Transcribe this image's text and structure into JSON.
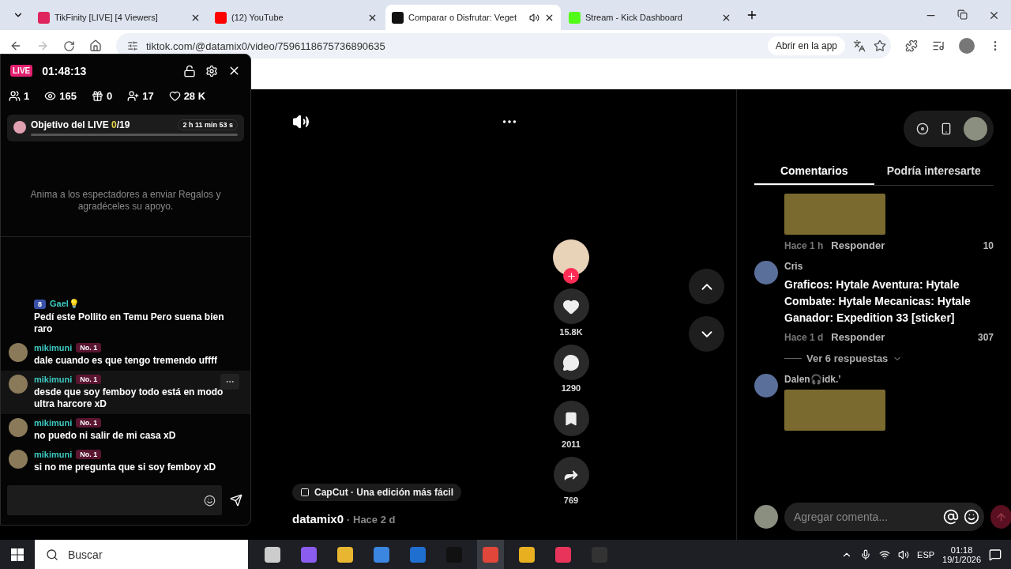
{
  "browser": {
    "tabs": [
      {
        "title": "TikFinity [LIVE] [4 Viewers]",
        "selected": false,
        "kind": "tikfinity",
        "audio": false
      },
      {
        "title": "(12) YouTube",
        "selected": false,
        "kind": "youtube",
        "audio": false
      },
      {
        "title": "Comparar o Disfrutar: Veget",
        "selected": true,
        "kind": "tiktok",
        "audio": true
      },
      {
        "title": "Stream - Kick Dashboard",
        "selected": false,
        "kind": "kick",
        "audio": false
      }
    ],
    "url": "tiktok.com/@datamix0/video/7596118675736890635",
    "open_app": "Abrir en la app"
  },
  "overlay": {
    "live_badge": "LIVE",
    "timer": "01:48:13",
    "stats": [
      {
        "kind": "users",
        "value": "1"
      },
      {
        "kind": "views",
        "value": "165"
      },
      {
        "kind": "gifts",
        "value": "0"
      },
      {
        "kind": "follows",
        "value": "17"
      },
      {
        "kind": "likes",
        "value": "28 K"
      }
    ],
    "goal": {
      "label": "Objetivo del LIVE",
      "current": "0",
      "total": "/19",
      "remaining": "2 h 11 min 53 s",
      "level": 0
    },
    "hint": "Anima a los espectadores a enviar Regalos y agradéceles su apoyo.",
    "messages": [
      {
        "user": "Gael💡",
        "avatar": false,
        "level_badge": "8",
        "text": "Pedí este Pollito en Temu Pero suena bien raro",
        "highlighted": false
      },
      {
        "user": "mikimuni",
        "avatar": true,
        "rank": "No. 1",
        "text": "dale cuando es que tengo tremendo uffff",
        "highlighted": false
      },
      {
        "user": "mikimuni",
        "avatar": true,
        "rank": "No. 1",
        "text": "desde que soy femboy todo está en modo ultra harcore xD",
        "highlighted": true
      },
      {
        "user": "mikimuni",
        "avatar": true,
        "rank": "No. 1",
        "text": "no puedo ni salir de mi casa xD",
        "highlighted": false
      },
      {
        "user": "mikimuni",
        "avatar": true,
        "rank": "No. 1",
        "text": "si no me pregunta que si soy femboy xD",
        "highlighted": false
      }
    ]
  },
  "video": {
    "actions": [
      {
        "kind": "like",
        "count": "15.8K"
      },
      {
        "kind": "comment",
        "count": "1290"
      },
      {
        "kind": "save",
        "count": "2011"
      },
      {
        "kind": "share",
        "count": "769"
      }
    ],
    "tool_chip": "CapCut · Una edición más fácil",
    "author": "datamix0",
    "posted": "· Hace 2 d"
  },
  "comments_panel": {
    "tabs": [
      {
        "label": "Comentarios",
        "selected": true
      },
      {
        "label": "Podría interesarte",
        "selected": false
      }
    ],
    "comments": [
      {
        "image": true,
        "time": "Hace 1 h",
        "reply": "Responder",
        "likes": "10"
      },
      {
        "user": "Cris",
        "text": "Graficos: Hytale Aventura: Hytale Combate: Hytale Mecanicas: Hytale Ganador: Expedition 33 [sticker]",
        "image": false,
        "time": "Hace 1 d",
        "reply": "Responder",
        "likes": "307",
        "replies": "Ver 6 respuestas"
      },
      {
        "user": "Dalen🎧idk.’",
        "image": true
      }
    ],
    "input_placeholder": "Agregar comenta..."
  },
  "taskbar": {
    "search_placeholder": "Buscar",
    "language": "ESP",
    "time": "01:18",
    "date": "19/1/2026"
  }
}
